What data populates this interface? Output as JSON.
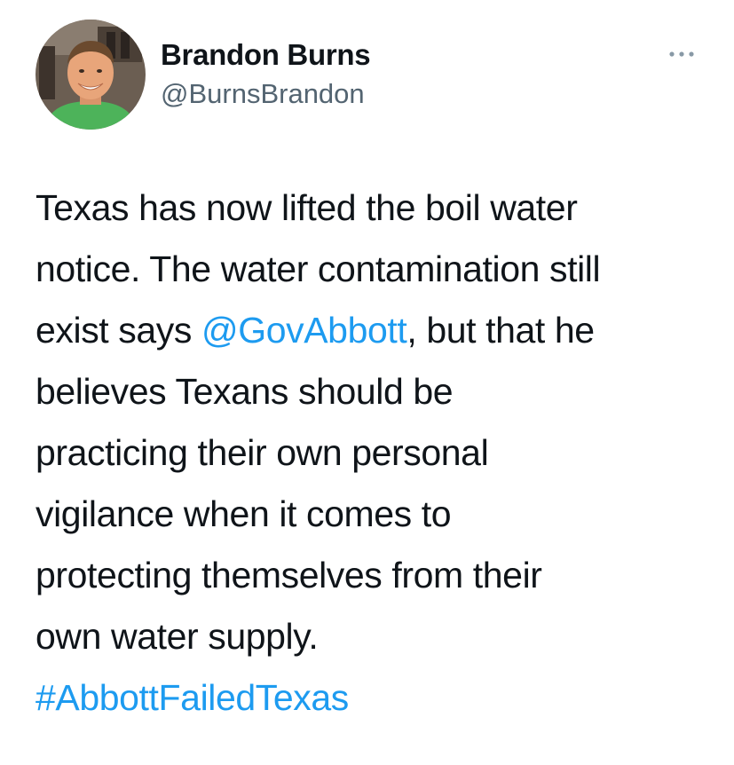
{
  "author": {
    "display_name": "Brandon Burns",
    "handle": "@BurnsBrandon"
  },
  "menu": {
    "icon": "more-horizontal-icon"
  },
  "tweet": {
    "line1": "Texas has now lifted the boil water",
    "line2": "notice. The water contamination still",
    "line3_before": "exist says ",
    "mention": "@GovAbbott",
    "line3_after": ", but that he",
    "line4": "believes Texans should be",
    "line5": "practicing their own personal",
    "line6": "vigilance when it comes to",
    "line7": "protecting themselves from their",
    "line8": "own water supply.",
    "hashtag": "#AbbottFailedTexas"
  },
  "colors": {
    "link": "#1d9bf0",
    "text": "#0f1419",
    "secondary": "#536471"
  }
}
